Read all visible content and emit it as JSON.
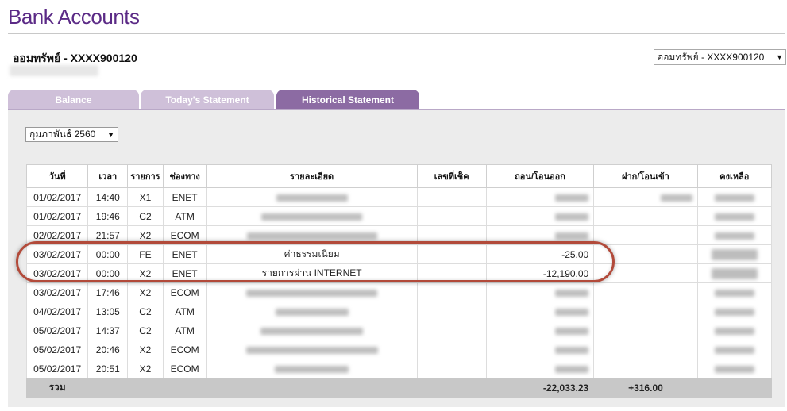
{
  "page": {
    "title": "Bank Accounts"
  },
  "account": {
    "name": "ออมทรัพย์ - XXXX900120",
    "selector_value": "ออมทรัพย์ - XXXX900120"
  },
  "tabs": [
    {
      "label": "Balance",
      "active": false
    },
    {
      "label": "Today's Statement",
      "active": false
    },
    {
      "label": "Historical Statement",
      "active": true
    }
  ],
  "filter": {
    "month_value": "กุมภาพันธ์ 2560"
  },
  "table": {
    "headers": [
      "วันที่",
      "เวลา",
      "รายการ",
      "ช่องทาง",
      "รายละเอียด",
      "เลขที่เช็ค",
      "ถอน/โอนออก",
      "ฝาก/โอนเข้า",
      "คงเหลือ"
    ],
    "rows": [
      {
        "date": "01/02/2017",
        "time": "14:40",
        "code": "X1",
        "channel": "ENET",
        "description": "",
        "cheque": "",
        "withdrawal": "",
        "deposit": "",
        "balance": ""
      },
      {
        "date": "01/02/2017",
        "time": "19:46",
        "code": "C2",
        "channel": "ATM",
        "description": "",
        "cheque": "",
        "withdrawal": "",
        "deposit": "",
        "balance": ""
      },
      {
        "date": "02/02/2017",
        "time": "21:57",
        "code": "X2",
        "channel": "ECOM",
        "description": "",
        "cheque": "",
        "withdrawal": "",
        "deposit": "",
        "balance": ""
      },
      {
        "date": "03/02/2017",
        "time": "00:00",
        "code": "FE",
        "channel": "ENET",
        "description": "ค่าธรรมเนียม",
        "cheque": "",
        "withdrawal": "-25.00",
        "deposit": "",
        "balance": ""
      },
      {
        "date": "03/02/2017",
        "time": "00:00",
        "code": "X2",
        "channel": "ENET",
        "description": "รายการผ่าน INTERNET",
        "cheque": "",
        "withdrawal": "-12,190.00",
        "deposit": "",
        "balance": ""
      },
      {
        "date": "03/02/2017",
        "time": "17:46",
        "code": "X2",
        "channel": "ECOM",
        "description": "",
        "cheque": "",
        "withdrawal": "",
        "deposit": "",
        "balance": ""
      },
      {
        "date": "04/02/2017",
        "time": "13:05",
        "code": "C2",
        "channel": "ATM",
        "description": "",
        "cheque": "",
        "withdrawal": "",
        "deposit": "",
        "balance": ""
      },
      {
        "date": "05/02/2017",
        "time": "14:37",
        "code": "C2",
        "channel": "ATM",
        "description": "",
        "cheque": "",
        "withdrawal": "",
        "deposit": "",
        "balance": ""
      },
      {
        "date": "05/02/2017",
        "time": "20:46",
        "code": "X2",
        "channel": "ECOM",
        "description": "",
        "cheque": "",
        "withdrawal": "",
        "deposit": "",
        "balance": ""
      },
      {
        "date": "05/02/2017",
        "time": "20:51",
        "code": "X2",
        "channel": "ECOM",
        "description": "",
        "cheque": "",
        "withdrawal": "",
        "deposit": "",
        "balance": ""
      }
    ],
    "total": {
      "label": "รวม",
      "withdrawal": "-22,033.23",
      "deposit": "+316.00"
    }
  },
  "colors": {
    "brand": "#5b2a86",
    "tab_active": "#8c6ba3",
    "tab_inactive": "#cfc0d9",
    "highlight": "#b24a3a"
  }
}
